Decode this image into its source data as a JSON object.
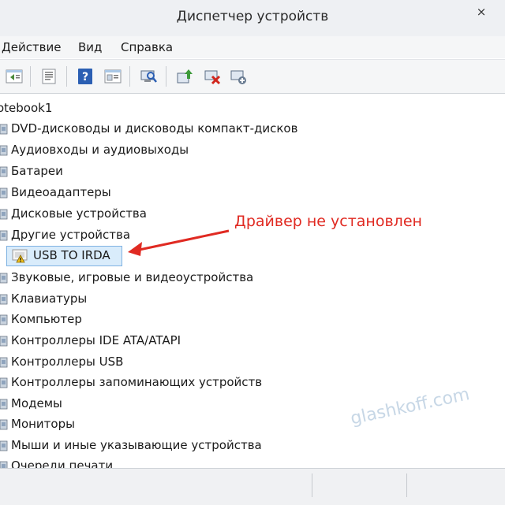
{
  "window": {
    "title": "Диспетчер устройств",
    "close_glyph": "×"
  },
  "menu": {
    "items": [
      "Действие",
      "Вид",
      "Справка"
    ]
  },
  "toolbar": {
    "buttons": [
      "back-icon",
      "properties-icon",
      "help-icon",
      "view-icon",
      "scan-hardware-icon",
      "update-driver-icon",
      "uninstall-icon",
      "add-device-icon"
    ]
  },
  "tree": {
    "root": "otebook1",
    "categories": [
      "DVD-дисководы и дисководы компакт-дисков",
      "Аудиовходы и аудиовыходы",
      "Батареи",
      "Видеоадаптеры",
      "Дисковые устройства",
      "Другие устройства",
      "Звуковые, игровые и видеоустройства",
      "Клавиатуры",
      "Компьютер",
      "Контроллеры IDE ATA/ATAPI",
      "Контроллеры USB",
      "Контроллеры запоминающих устройств",
      "Модемы",
      "Мониторы",
      "Мыши и иные указывающие устройства",
      "Очереди печати"
    ],
    "selected_child": "USB TO IRDA"
  },
  "annotation": {
    "text": "Драйвер не установлен",
    "color": "#e02a22"
  },
  "watermark": "glashkoff.com"
}
